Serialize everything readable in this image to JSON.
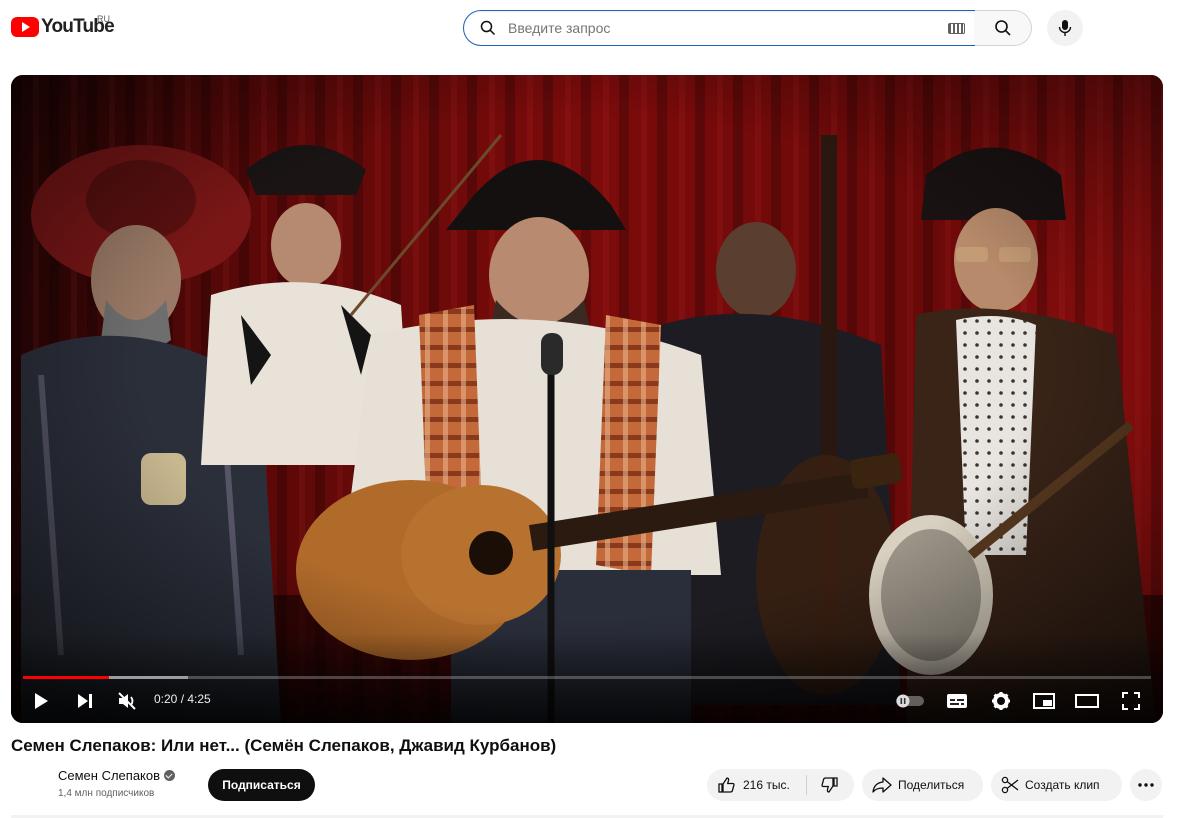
{
  "masthead": {
    "logo_text": "YouTube",
    "region": "RU",
    "search_placeholder": "Введите запрос",
    "icons": [
      "youtube-logo",
      "search-icon",
      "keyboard-icon",
      "mic-icon"
    ]
  },
  "player": {
    "time_display": "0:20 / 4:25",
    "progress_played_fraction": 0.076,
    "progress_buffered_fraction": 0.146,
    "muted": true,
    "autoplay_on": false,
    "colors": {
      "progress": "#ff0000",
      "curtain": "#8b0000"
    }
  },
  "video": {
    "title": "Семен Слепаков: Или нет... (Семён Слепаков, Джавид Курбанов)"
  },
  "channel": {
    "name": "Семен Слепаков",
    "subscribers": "1,4 млн подписчиков",
    "subscribe_label": "Подписаться"
  },
  "actions": {
    "likes": "216 тыс.",
    "share_label": "Поделиться",
    "clip_label": "Создать клип"
  }
}
